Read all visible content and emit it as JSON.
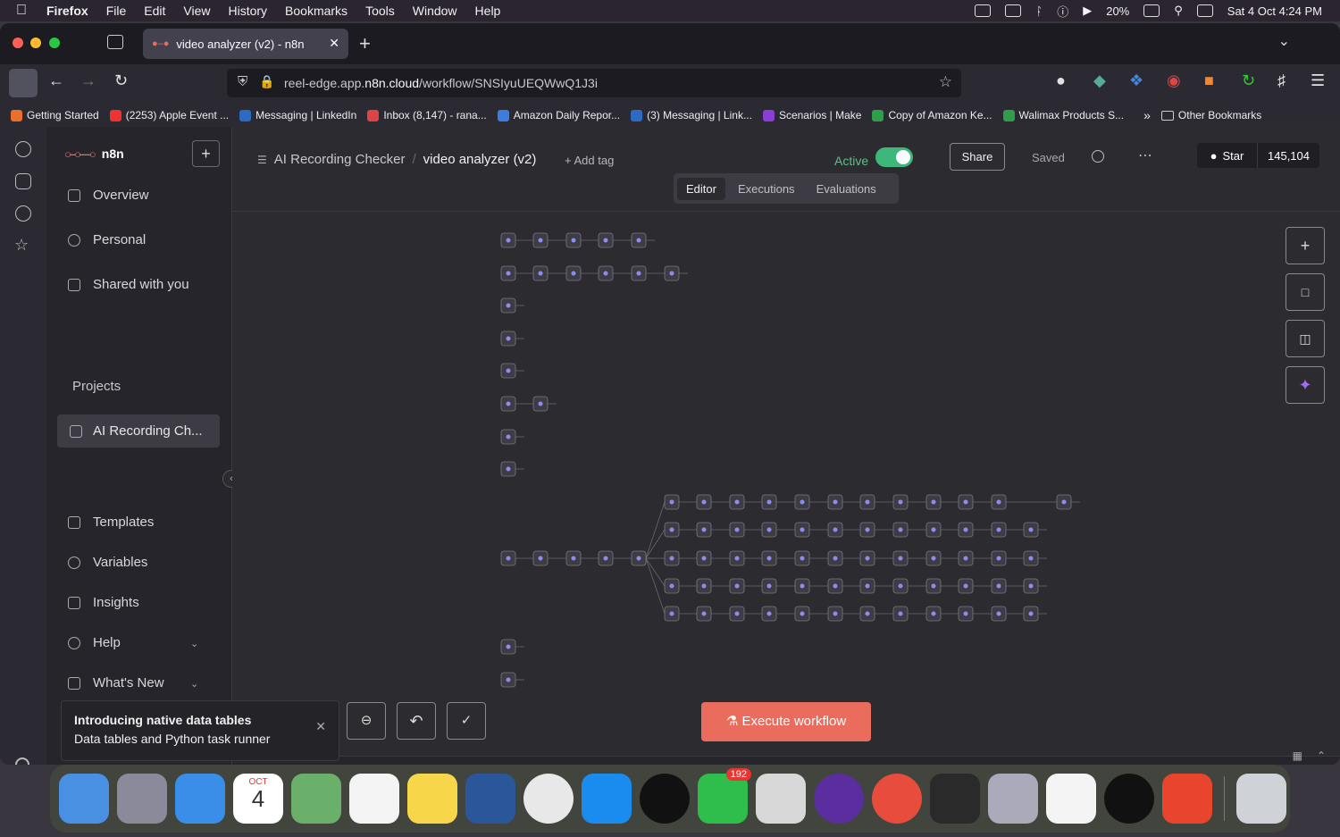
{
  "menubar": {
    "app": "Firefox",
    "items": [
      "File",
      "Edit",
      "View",
      "History",
      "Bookmarks",
      "Tools",
      "Window",
      "Help"
    ],
    "battery": "20%",
    "clock": "Sat 4 Oct  4:24 PM"
  },
  "browser": {
    "tab_title": "video analyzer (v2) - n8n",
    "url_prefix": "reel-edge.app.",
    "url_host": "n8n.cloud",
    "url_path": "/workflow/SNSIyuUEQWwQ1J3i",
    "bookmarks": [
      {
        "label": "Getting Started",
        "color": "#e8702a"
      },
      {
        "label": "(2253) Apple Event ...",
        "color": "#e33"
      },
      {
        "label": "Messaging | LinkedIn",
        "color": "#2d6bc2"
      },
      {
        "label": "Inbox (8,147) - rana...",
        "color": "#d44"
      },
      {
        "label": "Amazon Daily Repor...",
        "color": "#3d7de0"
      },
      {
        "label": "(3) Messaging | Link...",
        "color": "#2d6bc2"
      },
      {
        "label": "Scenarios | Make",
        "color": "#8a3ed6"
      },
      {
        "label": "Copy of Amazon Ke...",
        "color": "#2e9e4a"
      },
      {
        "label": "Walimax Products S...",
        "color": "#2e9e4a"
      }
    ],
    "other_bookmarks": "Other Bookmarks"
  },
  "sidebar": {
    "brand": "n8n",
    "nav": [
      "Overview",
      "Personal",
      "Shared with you"
    ],
    "projects_label": "Projects",
    "project_item": "AI Recording Ch...",
    "bottom_nav": [
      "Templates",
      "Variables",
      "Insights",
      "Help",
      "What's New"
    ]
  },
  "header": {
    "project": "AI Recording Checker",
    "workflow": "video analyzer (v2)",
    "add_tag": "+ Add tag",
    "active_label": "Active",
    "share": "Share",
    "saved": "Saved",
    "star": "Star",
    "star_count": "145,104",
    "tabs": [
      "Editor",
      "Executions",
      "Evaluations"
    ]
  },
  "canvas": {
    "execute": "Execute workflow",
    "colors": {
      "node": "#3d3c44",
      "line": "#6a6970",
      "accent": "#e96c5d"
    }
  },
  "toast": {
    "title": "Introducing native data tables",
    "message": "Data tables and Python task runner"
  },
  "dock": {
    "calendar_month": "OCT",
    "calendar_day": "4",
    "whatsapp_badge": "192"
  }
}
